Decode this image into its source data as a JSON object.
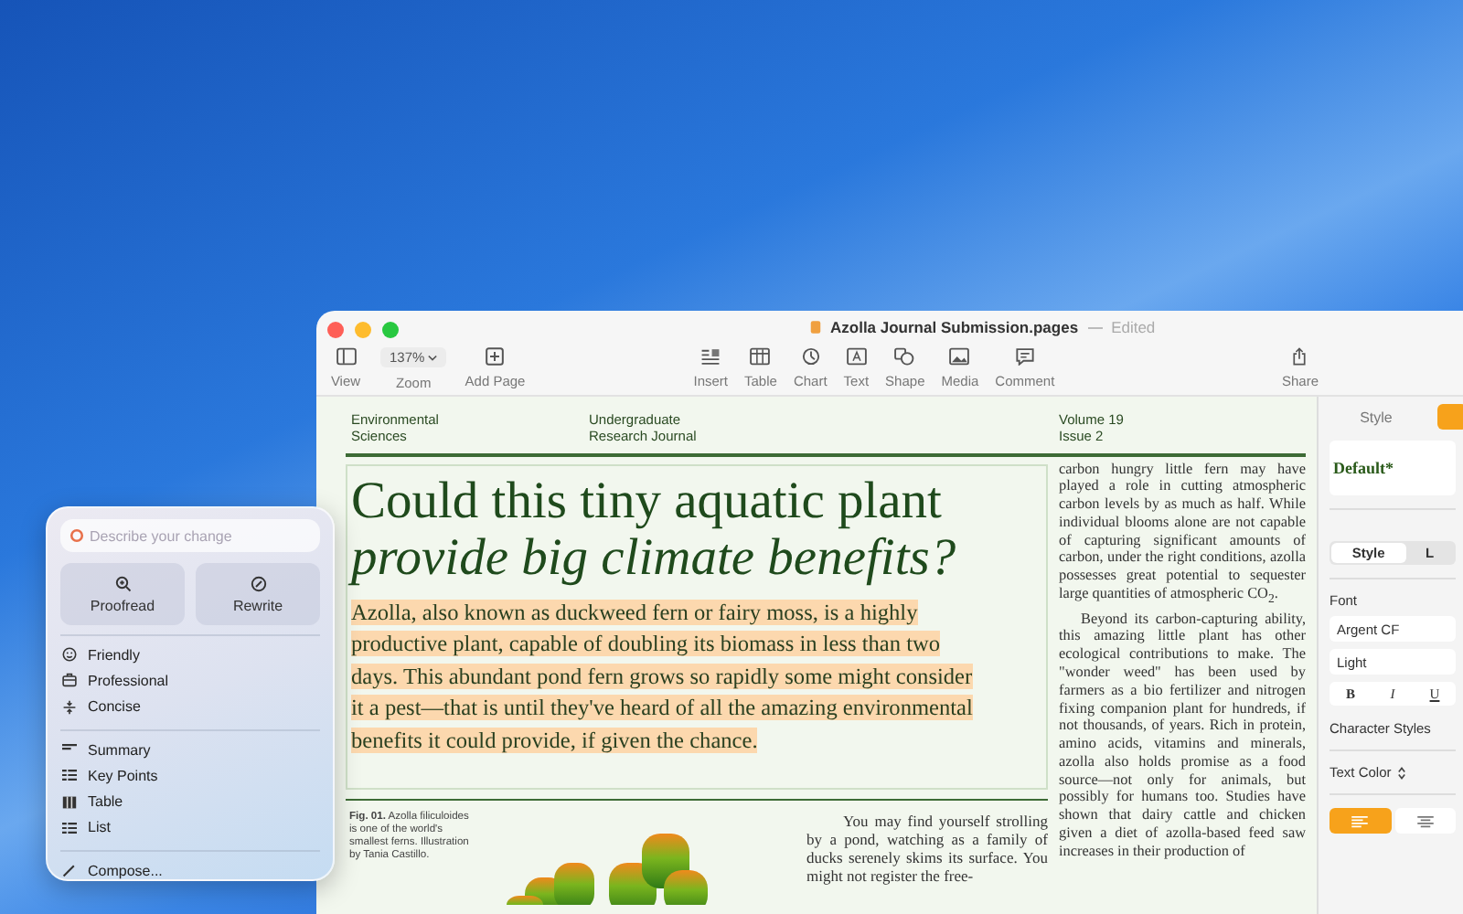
{
  "window": {
    "title": "Azolla Journal Submission.pages",
    "status": "Edited"
  },
  "toolbar": {
    "left": [
      {
        "kind": "button",
        "label": "View"
      },
      {
        "kind": "dropdown",
        "label": "Zoom",
        "value": "137%"
      },
      {
        "kind": "button",
        "label": "Add Page"
      }
    ],
    "center": [
      {
        "label": "Insert"
      },
      {
        "label": "Table"
      },
      {
        "label": "Chart"
      },
      {
        "label": "Text"
      },
      {
        "label": "Shape"
      },
      {
        "label": "Media"
      },
      {
        "label": "Comment"
      }
    ],
    "right": [
      {
        "label": "Share"
      }
    ]
  },
  "document": {
    "header": [
      {
        "lines": [
          "Environmental",
          "Sciences"
        ]
      },
      {
        "lines": [
          "Undergraduate",
          "Research Journal"
        ]
      },
      {
        "lines": [
          "Volume 19",
          "Issue 2"
        ]
      }
    ],
    "headline": {
      "line1": "Could this tiny aquatic plant",
      "line2": "provide big climate benefits?"
    },
    "lead": {
      "text": "Azolla, also known as duckweed fern or fairy moss, is a highly productive plant, capable of doubling its biomass in less than two days. This abundant pond fern grows so rapidly some might consider it a pest—that is until they've heard of all the amazing environmental benefits it could provide, if given the chance.",
      "highlighted": true
    },
    "side_column": [
      "carbon hungry little fern may have played a role in cutting atmospheric carbon levels by as much as half. While individual blooms alone are not capable of capturing significant amounts of carbon, under the right conditions, azolla possesses great potential to sequester large quantities of atmospheric CO$_{2}$.",
      "Beyond its carbon-capturing ability, this amazing little plant has other ecological contributions to make. The \"wonder weed\" has been used by farmers as a bio fertilizer and nitrogen fixing companion plant for hundreds, if not thousands, of years. Rich in protein, amino acids, vitamins and minerals, azolla also holds promise as a food source—not only for animals, but possibly for humans too. Studies have shown that dairy cattle and chicken given a diet of azolla-based feed saw increases in their production of"
    ],
    "caption": "**Fig. 01.** Azolla filiculoides is one of the world's smallest ferns. Illustration by Tania Castillo.",
    "body": "You may find yourself strolling by a pond, watching as a family of ducks serenely skims its surface. You might not register the free-"
  },
  "sidebar": {
    "tabs": [
      {
        "label": "Style",
        "selected": false
      },
      {
        "selected": true
      }
    ],
    "paragraph_style": "Default*",
    "segments": [
      {
        "label": "Style",
        "selected": true
      },
      {
        "label": "L",
        "selected": false
      }
    ],
    "font_label": "Font",
    "font_family": "Argent CF",
    "typeface": "Light",
    "text_styles": [
      {
        "label": "B",
        "selected": false
      },
      {
        "label": "I",
        "selected": false
      },
      {
        "label": "U",
        "selected": false
      }
    ],
    "character_styles": "Character Styles",
    "text_color": "Text Color",
    "alignment": [
      {
        "selected": true
      },
      {
        "selected": false
      }
    ]
  },
  "writing_tools": {
    "placeholder": "Describe your change",
    "actions": [
      {
        "label": "Proofread"
      },
      {
        "label": "Rewrite"
      }
    ],
    "groups": [
      {
        "items": [
          {
            "label": "Friendly"
          },
          {
            "label": "Professional"
          },
          {
            "label": "Concise"
          }
        ]
      },
      {
        "items": [
          {
            "label": "Summary"
          },
          {
            "label": "Key Points"
          },
          {
            "label": "Table"
          },
          {
            "label": "List"
          }
        ]
      },
      {
        "items": [
          {
            "label": "Compose..."
          }
        ]
      }
    ]
  }
}
